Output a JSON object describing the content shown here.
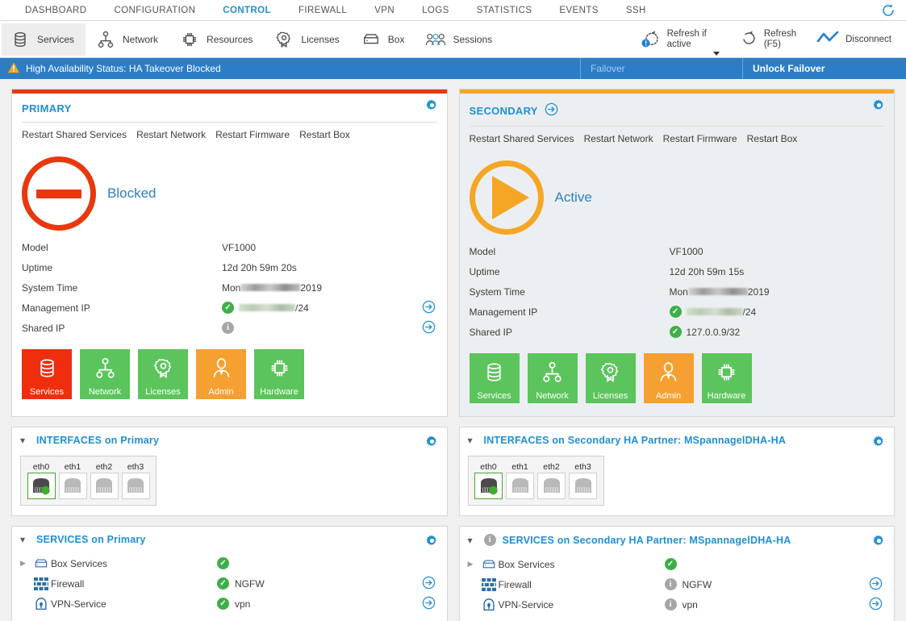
{
  "menu": {
    "items": [
      {
        "label": "DASHBOARD",
        "active": false
      },
      {
        "label": "CONFIGURATION",
        "active": false
      },
      {
        "label": "CONTROL",
        "active": true
      },
      {
        "label": "FIREWALL",
        "active": false
      },
      {
        "label": "VPN",
        "active": false
      },
      {
        "label": "LOGS",
        "active": false
      },
      {
        "label": "STATISTICS",
        "active": false
      },
      {
        "label": "EVENTS",
        "active": false
      },
      {
        "label": "SSH",
        "active": false
      }
    ],
    "refresh_icon": "refresh-icon"
  },
  "toolbar": {
    "items": [
      {
        "label": "Services",
        "icon": "database-icon",
        "selected": true
      },
      {
        "label": "Network",
        "icon": "network-tree-icon",
        "selected": false
      },
      {
        "label": "Resources",
        "icon": "cpu-chip-icon",
        "selected": false
      },
      {
        "label": "Licenses",
        "icon": "rosette-icon",
        "selected": false
      },
      {
        "label": "Box",
        "icon": "server-box-icon",
        "selected": false
      },
      {
        "label": "Sessions",
        "icon": "users-icon",
        "selected": false
      }
    ],
    "right": {
      "refresh_if_active_line1": "Refresh if",
      "refresh_if_active_line2": "active",
      "refresh_line1": "Refresh",
      "refresh_line2": "(F5)",
      "disconnect": "Disconnect"
    }
  },
  "ha_bar": {
    "icon": "warning-triangle-icon",
    "status_text": "High Availability Status: HA Takeover Blocked",
    "failover_label": "Failover",
    "unlock_failover_label": "Unlock Failover",
    "background_color": "#2d7dc4"
  },
  "panels": {
    "primary": {
      "title": "PRIMARY",
      "accent_color": "#e8380d",
      "has_arrow": false,
      "restart_actions": [
        "Restart Shared Services",
        "Restart Network",
        "Restart Firmware",
        "Restart Box"
      ],
      "state": {
        "label": "Blocked",
        "icon": "blocked-dash-icon",
        "color": "#e8380d"
      },
      "details": [
        {
          "key": "Model",
          "value": "VF1000",
          "redacted": false,
          "badge": null,
          "arrow": false
        },
        {
          "key": "Uptime",
          "value": "12d 20h 59m 20s",
          "redacted": false,
          "badge": null,
          "arrow": false
        },
        {
          "key": "System Time",
          "value_prefix": "Mon",
          "value_suffix": "2019",
          "redacted": true,
          "badge": null,
          "arrow": false
        },
        {
          "key": "Management IP",
          "value_prefix": "",
          "value_suffix": "/24",
          "redacted": true,
          "badge": "ok",
          "arrow": true
        },
        {
          "key": "Shared IP",
          "value": "",
          "redacted": false,
          "badge": "info",
          "arrow": true
        }
      ],
      "tiles": [
        {
          "label": "Services",
          "icon": "database-icon",
          "color": "#f02d0d"
        },
        {
          "label": "Network",
          "icon": "network-tree-icon",
          "color": "#5cc45c"
        },
        {
          "label": "Licenses",
          "icon": "rosette-icon",
          "color": "#5cc45c"
        },
        {
          "label": "Admin",
          "icon": "person-icon",
          "color": "#f5a030"
        },
        {
          "label": "Hardware",
          "icon": "cpu-chip-icon",
          "color": "#5cc45c"
        }
      ]
    },
    "secondary": {
      "title": "SECONDARY",
      "accent_color": "#f5a623",
      "has_arrow": true,
      "restart_actions": [
        "Restart Shared Services",
        "Restart Network",
        "Restart Firmware",
        "Restart Box"
      ],
      "state": {
        "label": "Active",
        "icon": "play-triangle-icon",
        "color": "#f5a623"
      },
      "details": [
        {
          "key": "Model",
          "value": "VF1000",
          "redacted": false,
          "badge": null,
          "arrow": false
        },
        {
          "key": "Uptime",
          "value": "12d 20h 59m 15s",
          "redacted": false,
          "badge": null,
          "arrow": false
        },
        {
          "key": "System Time",
          "value_prefix": "Mon",
          "value_suffix": "2019",
          "redacted": true,
          "badge": null,
          "arrow": false
        },
        {
          "key": "Management IP",
          "value_prefix": "",
          "value_suffix": "/24",
          "redacted": true,
          "badge": "ok",
          "arrow": false
        },
        {
          "key": "Shared IP",
          "value": "127.0.0.9/32",
          "redacted": false,
          "badge": "ok",
          "arrow": false
        }
      ],
      "tiles": [
        {
          "label": "Services",
          "icon": "database-icon",
          "color": "#5cc45c"
        },
        {
          "label": "Network",
          "icon": "network-tree-icon",
          "color": "#5cc45c"
        },
        {
          "label": "Licenses",
          "icon": "rosette-icon",
          "color": "#5cc45c"
        },
        {
          "label": "Admin",
          "icon": "person-icon",
          "color": "#f5a030"
        },
        {
          "label": "Hardware",
          "icon": "cpu-chip-icon",
          "color": "#5cc45c"
        }
      ]
    }
  },
  "interfaces_cards": [
    {
      "title": "INTERFACES on Primary",
      "ports": [
        {
          "label": "eth0",
          "state": "up"
        },
        {
          "label": "eth1",
          "state": "down"
        },
        {
          "label": "eth2",
          "state": "down"
        },
        {
          "label": "eth3",
          "state": "down"
        }
      ]
    },
    {
      "title": "INTERFACES on Secondary HA Partner: MSpannagelDHA-HA",
      "ports": [
        {
          "label": "eth0",
          "state": "up"
        },
        {
          "label": "eth1",
          "state": "down"
        },
        {
          "label": "eth2",
          "state": "down"
        },
        {
          "label": "eth3",
          "state": "down"
        }
      ]
    }
  ],
  "services_cards": [
    {
      "title": "SERVICES on Primary",
      "head_badge": null,
      "rows": [
        {
          "expander": true,
          "icon": "server-box-icon",
          "name": "Box Services",
          "badge": "ok",
          "status": "",
          "arrow": false
        },
        {
          "expander": false,
          "icon": "firewall-icon",
          "name": "Firewall",
          "badge": "ok",
          "status": "NGFW",
          "arrow": true
        },
        {
          "expander": false,
          "icon": "vpn-icon",
          "name": "VPN-Service",
          "badge": "ok",
          "status": "vpn",
          "arrow": true
        }
      ]
    },
    {
      "title": "SERVICES on Secondary HA Partner: MSpannagelDHA-HA",
      "head_badge": "info",
      "rows": [
        {
          "expander": true,
          "icon": "server-box-icon",
          "name": "Box Services",
          "badge": "ok",
          "status": "",
          "arrow": false
        },
        {
          "expander": false,
          "icon": "firewall-icon",
          "name": "Firewall",
          "badge": "info",
          "status": "NGFW",
          "arrow": true
        },
        {
          "expander": false,
          "icon": "vpn-icon",
          "name": "VPN-Service",
          "badge": "info",
          "status": "vpn",
          "arrow": true
        }
      ]
    }
  ]
}
